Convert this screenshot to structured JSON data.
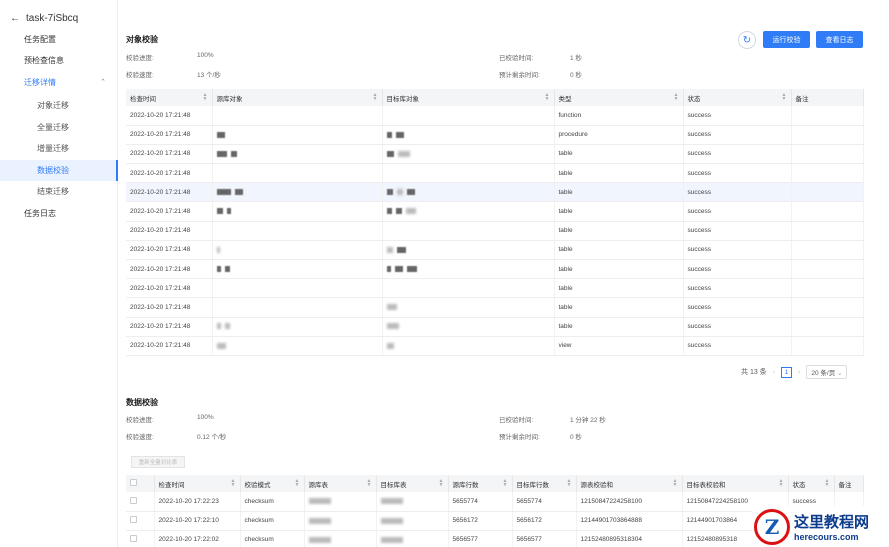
{
  "back": {
    "title": "task-7iSbcq"
  },
  "sidebar": {
    "items": [
      {
        "label": "任务配置"
      },
      {
        "label": "预检查信息"
      },
      {
        "label": "迁移详情"
      },
      {
        "label": "对象迁移"
      },
      {
        "label": "全量迁移"
      },
      {
        "label": "增量迁移"
      },
      {
        "label": "数据校验"
      },
      {
        "label": "结束迁移"
      },
      {
        "label": "任务日志"
      }
    ]
  },
  "object_check": {
    "title": "对象校验",
    "progress_label": "校验进度:",
    "progress_value": "100%",
    "speed_label": "校验速度:",
    "speed_value": "13 个/秒",
    "elapsed_label": "已校验时间:",
    "elapsed_value": "1 秒",
    "remain_label": "预计剩余时间:",
    "remain_value": "0 秒",
    "run_button": "运行校验",
    "log_button": "查看日志",
    "columns": [
      "检查时间",
      "源库对象",
      "目标库对象",
      "类型",
      "状态",
      "备注"
    ],
    "rows": [
      {
        "time": "2022-10-20 17:21:48",
        "type": "function",
        "status": "success"
      },
      {
        "time": "2022-10-20 17:21:48",
        "type": "procedure",
        "status": "success"
      },
      {
        "time": "2022-10-20 17:21:48",
        "type": "table",
        "status": "success"
      },
      {
        "time": "2022-10-20 17:21:48",
        "type": "table",
        "status": "success"
      },
      {
        "time": "2022-10-20 17:21:48",
        "type": "table",
        "status": "success"
      },
      {
        "time": "2022-10-20 17:21:48",
        "type": "table",
        "status": "success"
      },
      {
        "time": "2022-10-20 17:21:48",
        "type": "table",
        "status": "success"
      },
      {
        "time": "2022-10-20 17:21:48",
        "type": "table",
        "status": "success"
      },
      {
        "time": "2022-10-20 17:21:48",
        "type": "table",
        "status": "success"
      },
      {
        "time": "2022-10-20 17:21:48",
        "type": "table",
        "status": "success"
      },
      {
        "time": "2022-10-20 17:21:48",
        "type": "table",
        "status": "success"
      },
      {
        "time": "2022-10-20 17:21:48",
        "type": "table",
        "status": "success"
      },
      {
        "time": "2022-10-20 17:21:48",
        "type": "view",
        "status": "success"
      }
    ],
    "pagination": {
      "total": "共 13 条",
      "current": "1",
      "page_size": "20 条/页"
    }
  },
  "data_check": {
    "title": "数据校验",
    "progress_label": "校验进度:",
    "progress_value": "100%",
    "speed_label": "校验速度:",
    "speed_value": "0.12 个/秒",
    "elapsed_label": "已校验时间:",
    "elapsed_value": "1 分钟 22 秒",
    "remain_label": "预计剩余时间:",
    "remain_value": "0 秒",
    "recheck_button": "重新全量对比表",
    "columns": [
      "检查时间",
      "校验模式",
      "源库表",
      "目标库表",
      "源库行数",
      "目标库行数",
      "源表校验和",
      "目标表校验和",
      "状态",
      "备注"
    ],
    "rows": [
      {
        "time": "2022-10-20 17:22:23",
        "mode": "checksum",
        "src_rows": "5655774",
        "dst_rows": "5655774",
        "src_sum": "12150847224258100",
        "dst_sum": "12150847224258100",
        "status": "success"
      },
      {
        "time": "2022-10-20 17:22:10",
        "mode": "checksum",
        "src_rows": "5656172",
        "dst_rows": "5656172",
        "src_sum": "12144901703864888",
        "dst_sum": "12144901703864",
        "status": ""
      },
      {
        "time": "2022-10-20 17:22:02",
        "mode": "checksum",
        "src_rows": "5656577",
        "dst_rows": "5656577",
        "src_sum": "12152480895318304",
        "dst_sum": "12152480895318",
        "status": ""
      }
    ]
  },
  "watermark": {
    "name": "这里教程网",
    "url": "herecours.com"
  },
  "colors": {
    "accent": "#2f7cf6",
    "row_highlight": "#f1f6fe",
    "header_bg": "#f4f5f7"
  }
}
